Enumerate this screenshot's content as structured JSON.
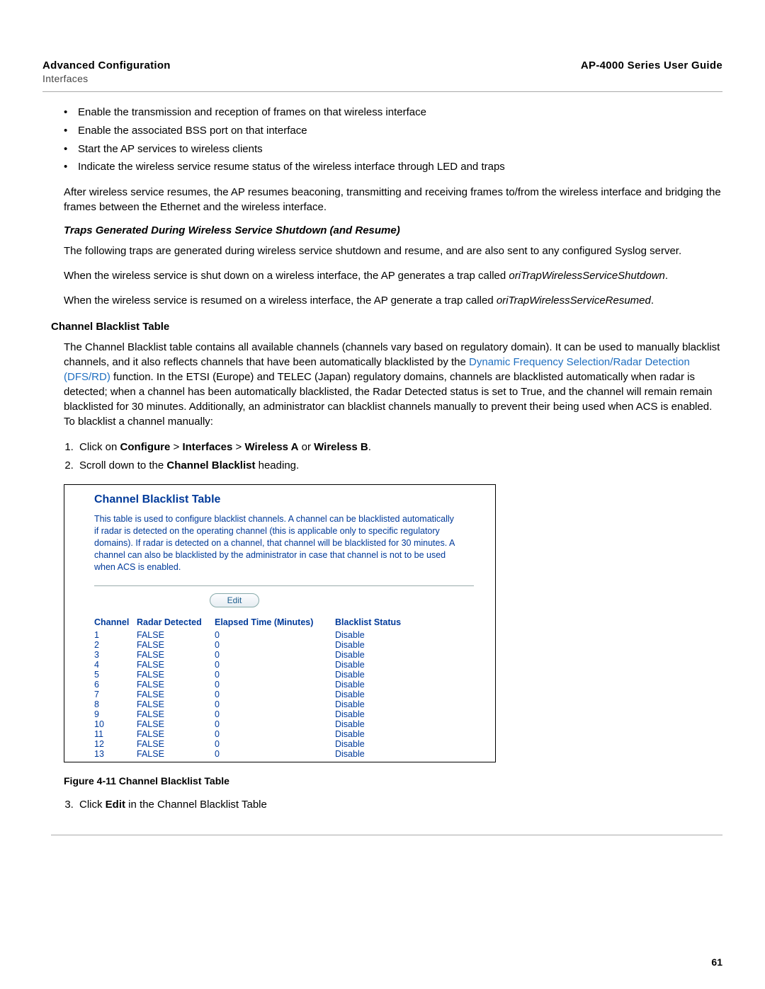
{
  "header": {
    "left_title": "Advanced Configuration",
    "left_sub": "Interfaces",
    "right_title": "AP-4000 Series User Guide"
  },
  "bullets": [
    "Enable the transmission and reception of frames on that wireless interface",
    "Enable the associated BSS port on that interface",
    "Start the AP services to wireless clients",
    "Indicate the wireless service resume status of the wireless interface through LED and traps"
  ],
  "para_after_bullets": "After wireless service resumes, the AP resumes beaconing, transmitting and receiving frames to/from the wireless interface and bridging the frames between the Ethernet and the wireless interface.",
  "traps_heading": "Traps Generated During Wireless Service Shutdown (and Resume)",
  "traps_intro": "The following traps are generated during wireless service shutdown and resume, and are also sent to any configured Syslog server.",
  "trap_shutdown_pre": "When the wireless service is shut down on a wireless interface, the AP generates a trap called ",
  "trap_shutdown_name": "oriTrapWirelessServiceShutdown",
  "trap_resume_pre": "When the wireless service is resumed on a wireless interface, the AP generate a trap called ",
  "trap_resume_name": "oriTrapWirelessServiceResumed",
  "blacklist_heading": "Channel Blacklist Table",
  "blacklist_para_pre": "The Channel Blacklist table contains all available channels (channels vary based on regulatory domain). It can be used to manually blacklist channels, and it also reflects channels that have been automatically blacklisted by the ",
  "blacklist_link": "Dynamic Frequency Selection/Radar Detection (DFS/RD)",
  "blacklist_para_post": " function. In the ETSI (Europe) and TELEC (Japan) regulatory domains, channels are blacklisted automatically when radar is detected; when a channel has been automatically blacklisted, the Radar Detected status is set to True, and the channel will remain remain blacklisted for 30 minutes. Additionally, an administrator can blacklist channels manually to prevent their being used when ACS is enabled. To blacklist a channel manually:",
  "steps": {
    "s1_pre": "Click on ",
    "s1_b1": "Configure",
    "s1_gt1": " > ",
    "s1_b2": "Interfaces",
    "s1_gt2": " > ",
    "s1_b3": "Wireless A",
    "s1_or": " or ",
    "s1_b4": "Wireless B",
    "s2_pre": "Scroll down to the ",
    "s2_b": "Channel Blacklist",
    "s2_post": " heading.",
    "s3_pre": "Click ",
    "s3_b": "Edit",
    "s3_post": " in the Channel Blacklist Table"
  },
  "figure": {
    "title": "Channel Blacklist Table",
    "desc": "This table is used to configure blacklist channels. A channel can be blacklisted automatically if radar is detected on the operating channel (this is applicable only to specific regulatory domains). If radar is detected on a channel, that channel will be blacklisted for 30 minutes. A channel can also be blacklisted by the administrator in case that channel is not to be used when ACS is enabled.",
    "edit_label": "Edit",
    "headers": [
      "Channel",
      "Radar Detected",
      "Elapsed Time (Minutes)",
      "Blacklist Status"
    ],
    "rows": [
      {
        "c": "1",
        "r": "FALSE",
        "e": "0",
        "s": "Disable"
      },
      {
        "c": "2",
        "r": "FALSE",
        "e": "0",
        "s": "Disable"
      },
      {
        "c": "3",
        "r": "FALSE",
        "e": "0",
        "s": "Disable"
      },
      {
        "c": "4",
        "r": "FALSE",
        "e": "0",
        "s": "Disable"
      },
      {
        "c": "5",
        "r": "FALSE",
        "e": "0",
        "s": "Disable"
      },
      {
        "c": "6",
        "r": "FALSE",
        "e": "0",
        "s": "Disable"
      },
      {
        "c": "7",
        "r": "FALSE",
        "e": "0",
        "s": "Disable"
      },
      {
        "c": "8",
        "r": "FALSE",
        "e": "0",
        "s": "Disable"
      },
      {
        "c": "9",
        "r": "FALSE",
        "e": "0",
        "s": "Disable"
      },
      {
        "c": "10",
        "r": "FALSE",
        "e": "0",
        "s": "Disable"
      },
      {
        "c": "11",
        "r": "FALSE",
        "e": "0",
        "s": "Disable"
      },
      {
        "c": "12",
        "r": "FALSE",
        "e": "0",
        "s": "Disable"
      },
      {
        "c": "13",
        "r": "FALSE",
        "e": "0",
        "s": "Disable"
      }
    ],
    "caption": "Figure 4-11 Channel Blacklist Table"
  },
  "page_number": "61"
}
